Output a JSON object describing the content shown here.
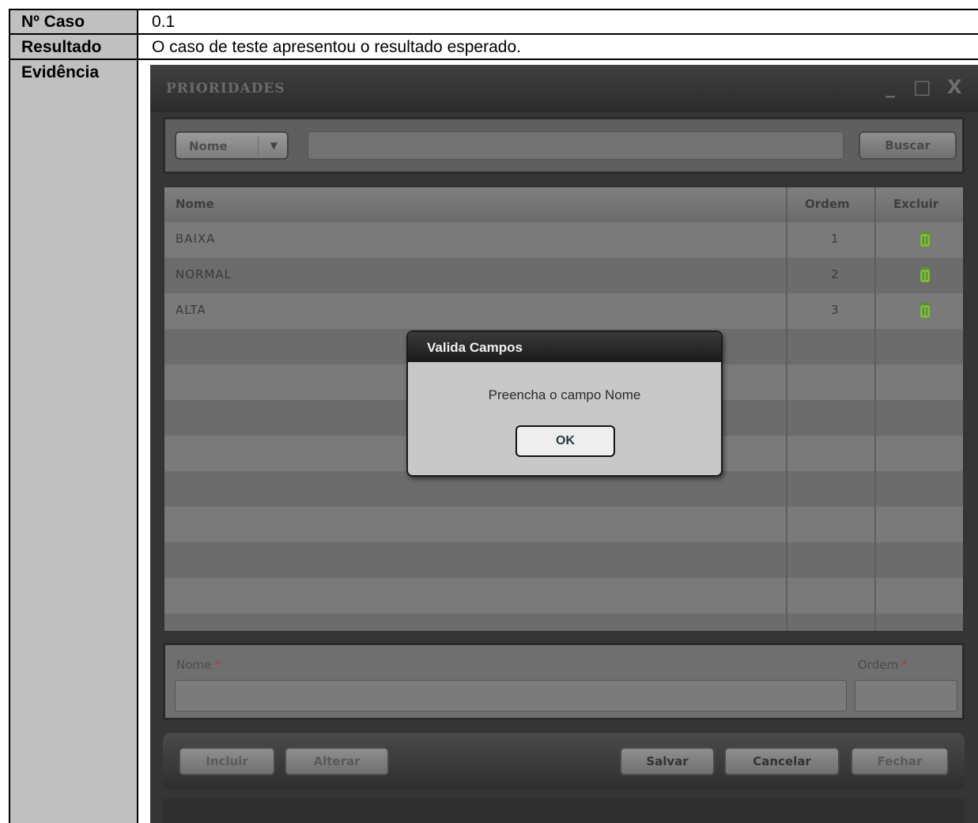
{
  "doc": {
    "rows": [
      {
        "label": "Nº Caso",
        "value": "0.1"
      },
      {
        "label": "Resultado",
        "value": "O caso de teste apresentou o resultado esperado."
      },
      {
        "label": "Evidência",
        "value": ""
      }
    ]
  },
  "window": {
    "title": "PRIORIDADES",
    "controls": {
      "minimize": "_",
      "maximize": "□",
      "close": "X"
    },
    "search": {
      "field_selected": "Nome",
      "query_value": "",
      "search_button": "Buscar"
    },
    "grid": {
      "columns": [
        "Nome",
        "Ordem",
        "Excluir"
      ],
      "rows": [
        {
          "nome": "BAIXA",
          "ordem": "1",
          "excluir_icon": "trash-icon"
        },
        {
          "nome": "NORMAL",
          "ordem": "2",
          "excluir_icon": "trash-icon"
        },
        {
          "nome": "ALTA",
          "ordem": "3",
          "excluir_icon": "trash-icon"
        }
      ]
    },
    "form": {
      "nome_label": "Nome",
      "ordem_label": "Ordem",
      "required_mark": "*",
      "nome_value": "",
      "ordem_value": ""
    },
    "buttons": {
      "incluir": "Incluir",
      "alterar": "Alterar",
      "salvar": "Salvar",
      "cancelar": "Cancelar",
      "fechar": "Fechar"
    }
  },
  "dialog": {
    "title": "Valida Campos",
    "message": "Preencha o campo Nome",
    "ok": "OK"
  },
  "colors": {
    "label_cell_bg": "#c0c0c0",
    "window_bg": "#353535",
    "required": "#b03a3a",
    "trash_green": "#7dbb3e"
  }
}
